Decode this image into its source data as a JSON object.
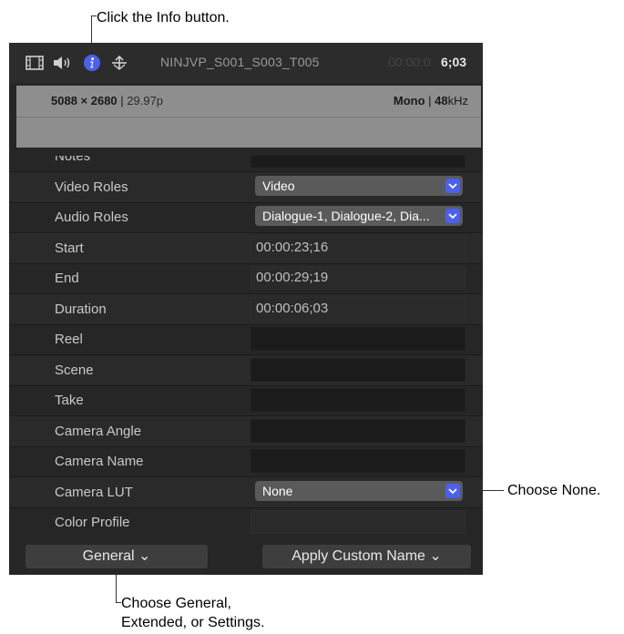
{
  "callouts": {
    "info": "Click the Info button.",
    "none": "Choose None.",
    "general_line1": "Choose General,",
    "general_line2": "Extended, or Settings."
  },
  "header": {
    "clip_name": "NINJVP_S001_S003_T005",
    "timecode_dim": "00:00:0",
    "timecode_bright": "6;03",
    "icons": [
      "film-icon",
      "speaker-icon",
      "info-icon",
      "share-icon"
    ]
  },
  "summary": {
    "resolution": "5088 × 2680",
    "frame_rate": "29.97p",
    "channels": "Mono",
    "sample_rate_value": "48",
    "sample_rate_unit": "kHz"
  },
  "rows": [
    {
      "label": "Notes",
      "kind": "field",
      "value": ""
    },
    {
      "label": "Video Roles",
      "kind": "dropdown",
      "value": "Video"
    },
    {
      "label": "Audio Roles",
      "kind": "dropdown",
      "value": "Dialogue-1, Dialogue-2, Dia..."
    },
    {
      "label": "Start",
      "kind": "readonly",
      "value": "00:00:23;16"
    },
    {
      "label": "End",
      "kind": "readonly",
      "value": "00:00:29;19"
    },
    {
      "label": "Duration",
      "kind": "readonly",
      "value": "00:00:06;03"
    },
    {
      "label": "Reel",
      "kind": "field",
      "value": ""
    },
    {
      "label": "Scene",
      "kind": "field",
      "value": ""
    },
    {
      "label": "Take",
      "kind": "field",
      "value": ""
    },
    {
      "label": "Camera Angle",
      "kind": "field",
      "value": ""
    },
    {
      "label": "Camera Name",
      "kind": "field",
      "value": ""
    },
    {
      "label": "Camera LUT",
      "kind": "dropdown",
      "value": "None"
    },
    {
      "label": "Color Profile",
      "kind": "readonly",
      "value": ""
    }
  ],
  "bottom": {
    "general_label": "General ⌄",
    "apply_label": "Apply Custom Name ⌄"
  },
  "colors": {
    "accent": "#4b5ff0",
    "panel_bg": "#262626"
  }
}
